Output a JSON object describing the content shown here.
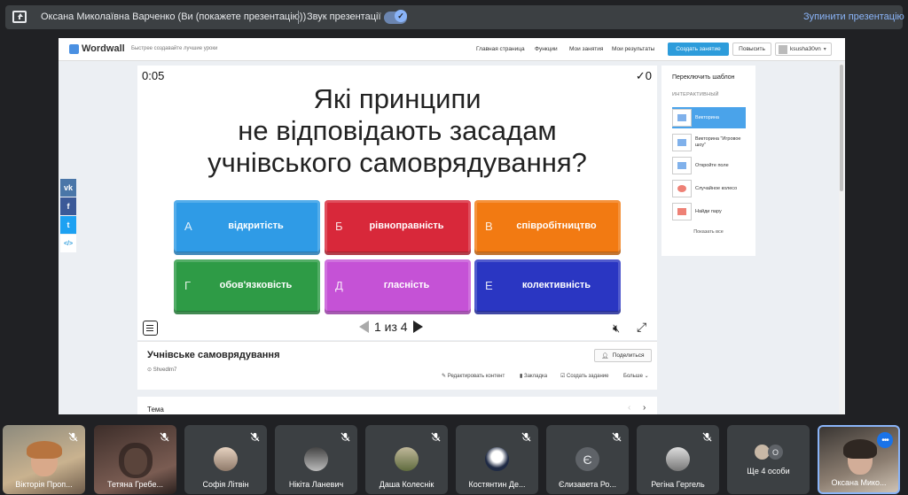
{
  "meet": {
    "presenting_title": "Оксана Миколаївна Варченко (Ви (покажете презентацію))",
    "separator": "|",
    "sound_label": "Звук презентації",
    "stop_label": "Зупинити презентацію",
    "accent_color": "#8ab4f8"
  },
  "wordwall": {
    "logo": "Wordwall",
    "tagline": "Быстрее создавайте лучшие уроки",
    "nav": [
      "Главная страница",
      "Функции",
      "Мои занятия",
      "Мои результаты"
    ],
    "create_label": "Создать занятие",
    "upgrade_label": "Повысить",
    "user_label": "ksusha30vn",
    "share_icons": [
      "vk-icon",
      "facebook-icon",
      "twitter-icon",
      "embed-icon"
    ],
    "share_glyphs": [
      "vk",
      "f",
      "t",
      "</>"
    ],
    "activity": {
      "timer": "0:05",
      "score": "✓0",
      "question_lines": [
        "Які принципи",
        "не відповідають засадам",
        "учнівського самоврядування?"
      ],
      "answers": [
        {
          "letter": "A",
          "text": "відкритість",
          "color": "#2f9be6"
        },
        {
          "letter": "Б",
          "text": "рівноправність",
          "color": "#d8283a"
        },
        {
          "letter": "B",
          "text": "співробітництво",
          "color": "#f27a12"
        },
        {
          "letter": "Г",
          "text": "обов'язковість",
          "color": "#2e9b46"
        },
        {
          "letter": "Д",
          "text": "гласність",
          "color": "#c552d6"
        },
        {
          "letter": "E",
          "text": "колективність",
          "color": "#2a36c2"
        }
      ],
      "pager": "1 из 4",
      "mute_glyph": "🔇︎",
      "fullscreen_glyph": "⤢"
    },
    "info": {
      "title": "Учнівське самоврядування",
      "author": "Shvedlm7",
      "share_label": "Поделиться",
      "actions": [
        "Редактировать контент",
        "Закладка",
        "Создать задание",
        "Больше"
      ]
    },
    "tema": {
      "label": "Тема"
    },
    "templates": {
      "heading": "Переключить шаблон",
      "sub": "ИНТЕРАКТИВНЫЙ",
      "items": [
        "Викторина",
        "Викторина \"Игровое шоу\"",
        "Откройте поле",
        "Случайное колесо",
        "Найди пару"
      ],
      "more": "Показать все"
    }
  },
  "participants": [
    {
      "name": "Вікторія Проп...",
      "type": "video"
    },
    {
      "name": "Тетяна Гребе...",
      "type": "video"
    },
    {
      "name": "Софія Літвін",
      "type": "avatar"
    },
    {
      "name": "Нікіта Ланевич",
      "type": "avatar"
    },
    {
      "name": "Даша Колеснік",
      "type": "avatar"
    },
    {
      "name": "Костянтин Де...",
      "type": "avatar"
    },
    {
      "name": "Єлизавета Ро...",
      "type": "letter",
      "letter": "Є"
    },
    {
      "name": "Регіна Гергель",
      "type": "avatar"
    },
    {
      "name": "Ще 4 особи",
      "type": "more"
    },
    {
      "name": "Оксана Мико...",
      "type": "self"
    }
  ]
}
